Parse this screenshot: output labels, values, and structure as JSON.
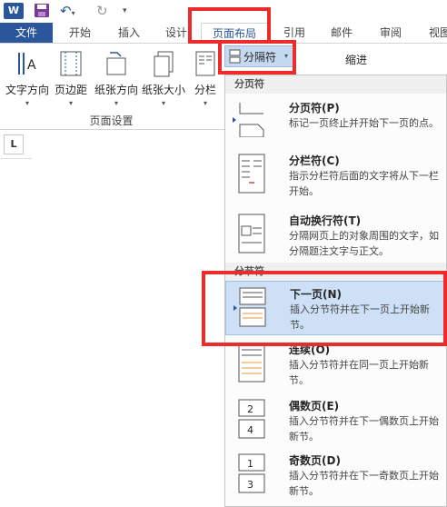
{
  "qat": {
    "app_icon_text": "W",
    "save": "save",
    "undo": "undo",
    "redo": "redo",
    "more": "customize"
  },
  "tabs": {
    "file": "文件",
    "home": "开始",
    "insert": "插入",
    "design": "设计",
    "layout": "页面布局",
    "references": "引用",
    "mailings": "邮件",
    "review": "审阅",
    "view": "视图"
  },
  "ribbon": {
    "text_direction": "文字方向",
    "margins": "页边距",
    "orientation": "纸张方向",
    "size": "纸张大小",
    "columns": "分栏",
    "breaks": "分隔符",
    "indent": "缩进",
    "group_page_setup": "页面设置"
  },
  "menu": {
    "section_page_breaks": "分页符",
    "section_section_breaks": "分节符",
    "items": [
      {
        "title": "分页符(P)",
        "desc": "标记一页终止并开始下一页的点。"
      },
      {
        "title": "分栏符(C)",
        "desc": "指示分栏符后面的文字将从下一栏开始。"
      },
      {
        "title": "自动换行符(T)",
        "desc": "分隔网页上的对象周围的文字，如分隔题注文字与正文。"
      },
      {
        "title": "下一页(N)",
        "desc": "插入分节符并在下一页上开始新节。"
      },
      {
        "title": "连续(O)",
        "desc": "插入分节符并在同一页上开始新节。"
      },
      {
        "title": "偶数页(E)",
        "desc": "插入分节符并在下一偶数页上开始新节。"
      },
      {
        "title": "奇数页(D)",
        "desc": "插入分节符并在下一奇数页上开始新节。"
      }
    ]
  },
  "ruler": {
    "tab_stop": "L"
  },
  "colors": {
    "accent": "#2b579a",
    "highlight": "#cde0f6",
    "annotation": "#ee2b2b"
  }
}
